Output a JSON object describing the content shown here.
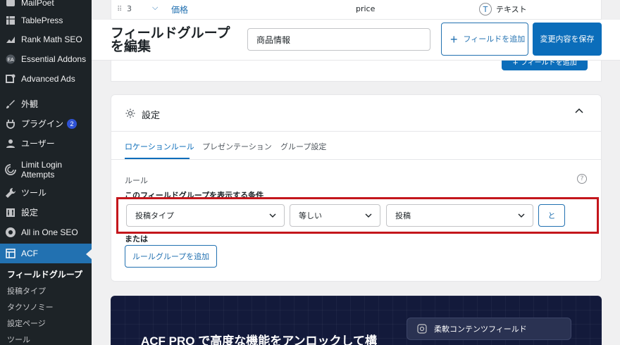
{
  "sidebar": {
    "items": [
      {
        "label": "MailPoet",
        "icon": "mailpoet-icon"
      },
      {
        "label": "TablePress",
        "icon": "tablepress-icon"
      },
      {
        "label": "Rank Math SEO",
        "icon": "rankmath-icon"
      },
      {
        "label": "Essential Addons",
        "icon": "essential-addons-icon"
      },
      {
        "label": "Advanced Ads",
        "icon": "advanced-ads-icon"
      },
      {
        "label": "外観",
        "icon": "brush-icon"
      },
      {
        "label": "プラグイン",
        "icon": "plugin-icon",
        "badge": "2"
      },
      {
        "label": "ユーザー",
        "icon": "user-icon"
      },
      {
        "label": "Limit Login Attempts",
        "icon": "limit-login-icon"
      },
      {
        "label": "ツール",
        "icon": "wrench-icon"
      },
      {
        "label": "設定",
        "icon": "settings-icon"
      },
      {
        "label": "All in One SEO",
        "icon": "aioseo-icon"
      },
      {
        "label": "ACF",
        "icon": "acf-icon"
      }
    ],
    "submenu": [
      "フィールドグループ",
      "投稿タイプ",
      "タクソノミー",
      "設定ページ",
      "ツール"
    ]
  },
  "field_row": {
    "drag": "⠿",
    "number": "3",
    "label": "価格",
    "name": "price",
    "type_icon": "T",
    "type": "テキスト"
  },
  "header": {
    "title": "フィールドグループを編集",
    "title_input_value": "商品情報",
    "add_field_label": "フィールドを追加",
    "save_label": "変更内容を保存"
  },
  "fields_footer": {
    "add_field_label": "+ フィールドを追加"
  },
  "settings": {
    "title": "設定",
    "tabs": [
      "ロケーションルール",
      "プレゼンテーション",
      "グループ設定"
    ],
    "rules_label": "ルール",
    "help": "?",
    "condition_label": "このフィールドグループを表示する条件",
    "rule": {
      "param": "投稿タイプ",
      "operator": "等しい",
      "value": "投稿",
      "and_label": "と"
    },
    "or_label": "または",
    "add_rule_group": "ルールグループを追加"
  },
  "promo": {
    "title": "ACF PRO で高度な機能をアンロックして構",
    "card_label": "柔軟コンテンツフィールド"
  },
  "colors": {
    "sidebar_bg": "#1d2327",
    "accent": "#2271b1",
    "primary_button": "#0b6dba",
    "highlight": "#c4161c",
    "promo_bg": "#131a3b"
  }
}
